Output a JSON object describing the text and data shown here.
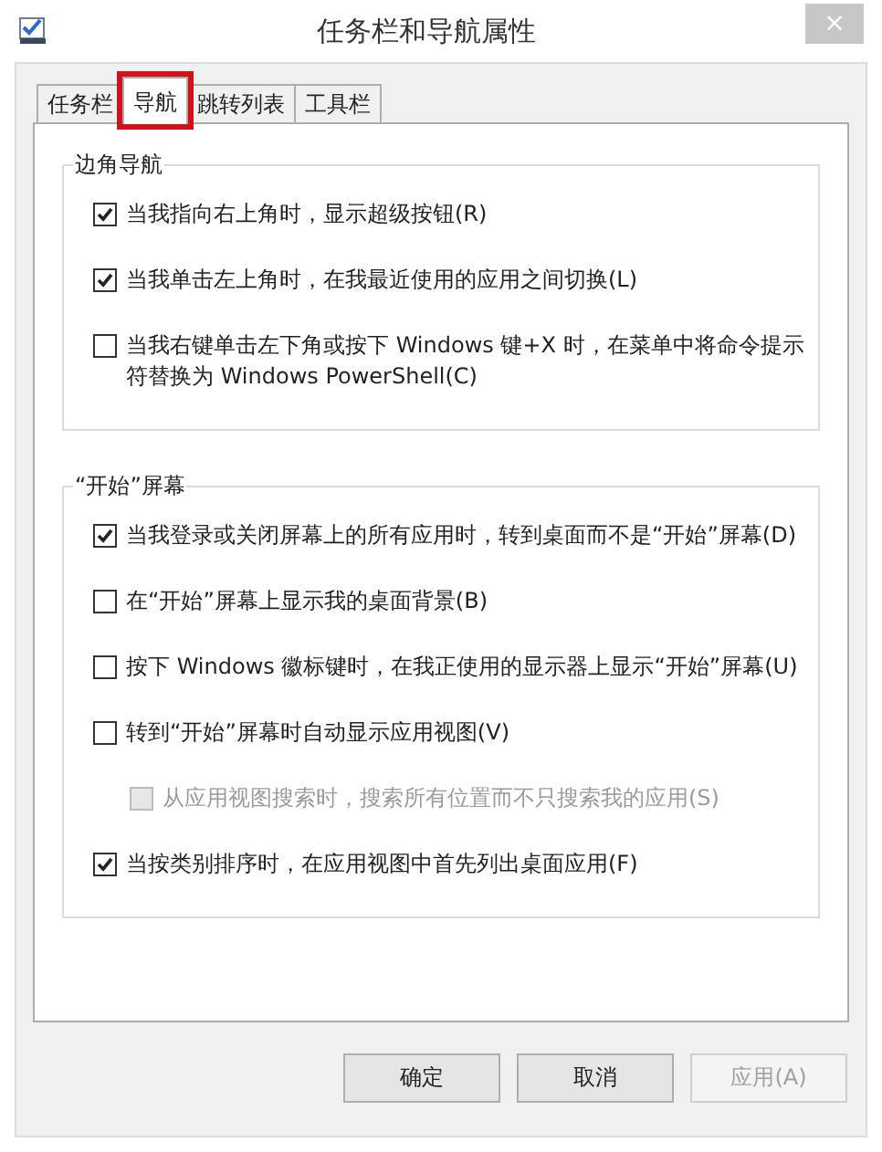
{
  "window": {
    "title": "任务栏和导航属性",
    "close": "×"
  },
  "tabs": [
    {
      "label": "任务栏",
      "selected": false,
      "highlighted": false
    },
    {
      "label": "导航",
      "selected": true,
      "highlighted": true
    },
    {
      "label": "跳转列表",
      "selected": false,
      "highlighted": false
    },
    {
      "label": "工具栏",
      "selected": false,
      "highlighted": false
    }
  ],
  "groups": [
    {
      "title": "边角导航",
      "options": [
        {
          "label": "当我指向右上角时，显示超级按钮(R)",
          "checked": true,
          "disabled": false
        },
        {
          "label": "当我单击左上角时，在我最近使用的应用之间切换(L)",
          "checked": true,
          "disabled": false
        },
        {
          "label": "当我右键单击左下角或按下 Windows 键+X 时，在菜单中将命令提示符替换为 Windows PowerShell(C)",
          "checked": false,
          "disabled": false
        }
      ]
    },
    {
      "title": "“开始”屏幕",
      "options": [
        {
          "label": "当我登录或关闭屏幕上的所有应用时，转到桌面而不是“开始”屏幕(D)",
          "checked": true,
          "disabled": false
        },
        {
          "label": "在“开始”屏幕上显示我的桌面背景(B)",
          "checked": false,
          "disabled": false
        },
        {
          "label": "按下 Windows 徽标键时，在我正使用的显示器上显示“开始”屏幕(U)",
          "checked": false,
          "disabled": false
        },
        {
          "label": "转到“开始”屏幕时自动显示应用视图(V)",
          "checked": false,
          "disabled": false,
          "children": [
            {
              "label": "从应用视图搜索时，搜索所有位置而不只搜索我的应用(S)",
              "checked": false,
              "disabled": true
            }
          ]
        },
        {
          "label": "当按类别排序时，在应用视图中首先列出桌面应用(F)",
          "checked": true,
          "disabled": false
        }
      ]
    }
  ],
  "buttons": [
    {
      "label": "确定",
      "disabled": false
    },
    {
      "label": "取消",
      "disabled": false
    },
    {
      "label": "应用(A)",
      "disabled": true
    }
  ]
}
